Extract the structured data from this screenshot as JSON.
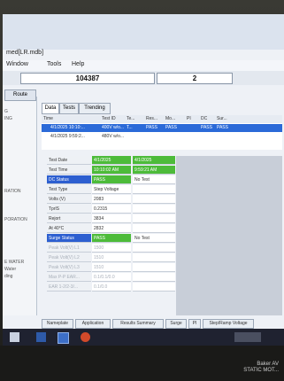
{
  "window": {
    "title": "med[LR.mdb]"
  },
  "menu": {
    "window": "Window",
    "tools": "Tools",
    "help": "Help"
  },
  "toolbar": {
    "serial": "104387",
    "field_count": "2"
  },
  "left_panel": {
    "route_tab": "Route",
    "items": [
      "G",
      "ING",
      "RATION",
      "PORATION",
      "E WATER",
      "Water",
      "ding"
    ]
  },
  "tabs": {
    "data": "Data",
    "tests": "Tests",
    "trending": "Trending"
  },
  "grid": {
    "headers": [
      "Time",
      "Test ID",
      "Te...",
      "Res...",
      "Mo...",
      "PI",
      "DC",
      "Sur..."
    ],
    "rows": [
      {
        "time": "4/1/2025 10:10:...",
        "test_id": "400V w/o...",
        "te": "T...",
        "res": "PASS",
        "mo": "PASS",
        "pi": "",
        "dc": "PASS",
        "sur": "PASS"
      },
      {
        "time": "4/1/2025 9:59:2...",
        "test_id": "480V w/o...",
        "te": "",
        "res": "",
        "mo": "",
        "pi": "",
        "dc": "",
        "sur": ""
      }
    ]
  },
  "detail": {
    "rows": [
      {
        "label": "Test Date",
        "v1": "4/1/2025",
        "v2": "4/1/2025"
      },
      {
        "label": "Test Time",
        "v1": "10:10:02 AM",
        "v2": "9:59:21 AM"
      },
      {
        "label": "DC Status",
        "v1": "PASS",
        "v2": "No Test"
      },
      {
        "label": "Test Type",
        "v1": "Step Voltage",
        "v2": ""
      },
      {
        "label": "Volts (V)",
        "v1": "2083",
        "v2": ""
      },
      {
        "label": "TprlS",
        "v1": "0.2315",
        "v2": ""
      },
      {
        "label": "Rejort",
        "v1": "3834",
        "v2": ""
      },
      {
        "label": "At 40°C",
        "v1": "2832",
        "v2": ""
      },
      {
        "label": "Surge Status",
        "v1": "PASS",
        "v2": "No Test"
      },
      {
        "label": "Peak Volt(V) L1",
        "v1": "1500",
        "v2": ""
      },
      {
        "label": "Peak Volt(V) L2",
        "v1": "1510",
        "v2": ""
      },
      {
        "label": "Peak Volt(V) L3",
        "v1": "1510",
        "v2": ""
      },
      {
        "label": "Max P-P EAR...",
        "v1": "0.1/0.1/0.0",
        "v2": ""
      },
      {
        "label": "EAR 1-2/2-3/...",
        "v1": "0.1/0.0",
        "v2": ""
      }
    ]
  },
  "bottom_tabs": [
    "Nameplate",
    "Application",
    "Results Summary",
    "Surge",
    "PI",
    "Step/Ramp Voltage"
  ],
  "colors": {
    "selection": "#2b6ad8",
    "pass_green": "#4dbb3a",
    "status_blue": "#2d5fd0",
    "taskbar": "#1f2230"
  },
  "brand": {
    "line1": "Baker AV",
    "line2": "STATIC MOT..."
  }
}
